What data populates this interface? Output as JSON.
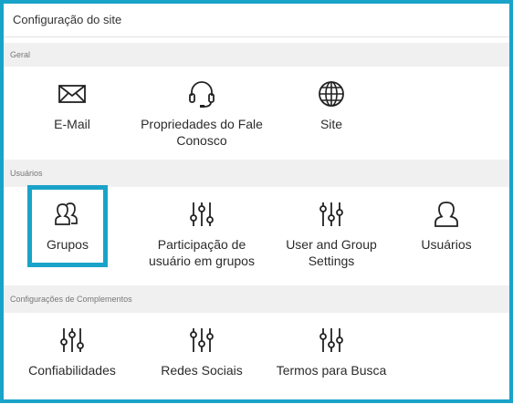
{
  "page": {
    "title": "Configuração do site"
  },
  "sections": [
    {
      "header": "Geral",
      "items": [
        {
          "label": "E-Mail",
          "icon": "envelope-icon"
        },
        {
          "label": "Propriedades do Fale Conosco",
          "icon": "headset-icon"
        },
        {
          "label": "Site",
          "icon": "globe-icon"
        }
      ]
    },
    {
      "header": "Usuários",
      "items": [
        {
          "label": "Grupos",
          "icon": "users-group-icon",
          "selected": true
        },
        {
          "label": "Participação de usuário em grupos",
          "icon": "sliders-icon"
        },
        {
          "label": "User and Group Settings",
          "icon": "sliders-icon"
        },
        {
          "label": "Usuários",
          "icon": "user-icon"
        }
      ]
    },
    {
      "header": "Configurações de Complementos",
      "items": [
        {
          "label": "Confiabilidades",
          "icon": "sliders-icon"
        },
        {
          "label": "Redes Sociais",
          "icon": "sliders-icon"
        },
        {
          "label": "Termos para Busca",
          "icon": "sliders-icon"
        }
      ]
    }
  ],
  "colors": {
    "accent": "#1aa3c9",
    "section_bg": "#f0f0f0"
  }
}
